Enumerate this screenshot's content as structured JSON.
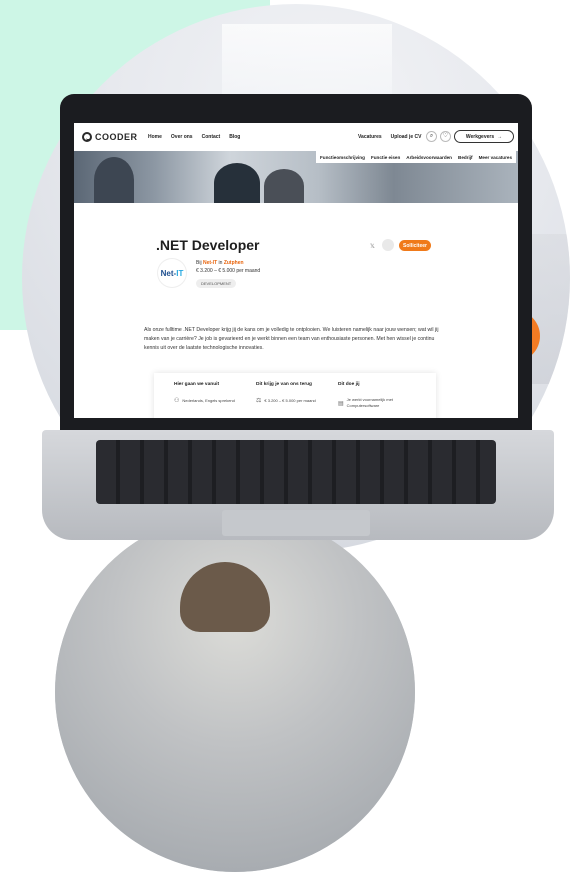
{
  "brand": {
    "logo_text": "COODER",
    "accent_color": "#f07a1a"
  },
  "nav": {
    "links": [
      "Home",
      "Over ons",
      "Contact",
      "Blog"
    ],
    "right_links": [
      "Vacatures",
      "Upload je CV"
    ],
    "search_icon": "search-icon",
    "favorites_icon": "heart-icon",
    "employer_button": "Werkgevers",
    "employer_arrow": "→"
  },
  "subnav": {
    "items": [
      "Functieomschrijving",
      "Functie eisen",
      "Arbeidsvoorwaarden",
      "Bedrijf",
      "Meer vacatures"
    ]
  },
  "job": {
    "title": ".NET Developer",
    "company_logo_main": "Net-",
    "company_logo_accent": "IT",
    "meta_prefix": "Bij",
    "company": "Net-IT",
    "meta_in": "in",
    "location": "Zutphen",
    "salary": "€ 3.200 – € 5.000 per maand",
    "tag": "DEVELOPMENT",
    "share_icon": "x-icon",
    "apply_button": "Solliciteer",
    "description": "Als onze fulltime .NET Developer krijg jij de kans om je volledig te ontplooien. We luisteren namelijk naar jouw wensen; wat wil jij maken van je carrière? Je job is gevarieerd en je werkt binnen een team van enthousiaste personen. Met hen wissel je continu kennis uit over de laatste technologische innovaties."
  },
  "card": {
    "col1_heading": "Hier gaan we vanuit",
    "col1_value": "Nederlands, Engels sprekend",
    "col2_heading": "Dit krijg je van ons terug",
    "col2_value": "€ 3.200 – € 5.000 per maand",
    "col3_heading": "Dit doe jij",
    "col3_value": "Je werkt voornamelijk met Computersoftware"
  }
}
